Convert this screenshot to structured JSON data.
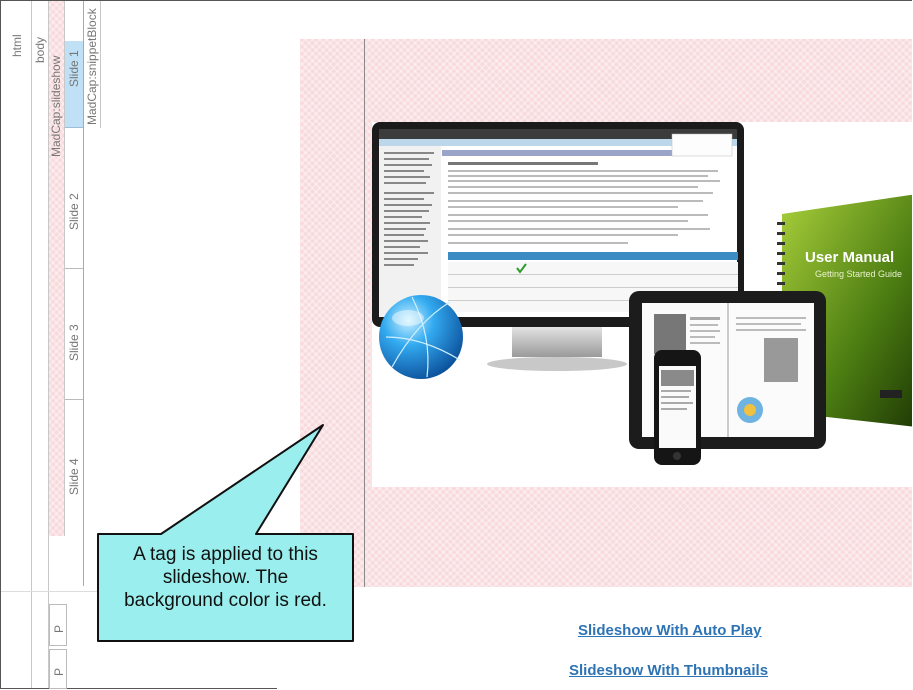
{
  "structure_bar": {
    "html_label": "html",
    "body_label": "body",
    "slideshow_label": "MadCap:slideshow",
    "slides": [
      "Slide 1",
      "Slide 2",
      "Slide 3",
      "Slide 4"
    ],
    "snippet_label": "MadCap:snippetBlock",
    "paragraph_labels": [
      "P",
      "P"
    ]
  },
  "callout": {
    "text_lines": [
      "A tag is applied to this",
      "slideshow. The",
      "background color is red."
    ]
  },
  "slide_image": {
    "manual_title": "User Manual",
    "manual_subtitle": "Getting Started Guide"
  },
  "links": {
    "auto_play": "Slideshow With Auto Play",
    "thumbnails": "Slideshow With Thumbnails"
  },
  "colors": {
    "slideshow_bg": "#f8d9dc",
    "selected_slide": "#bfe0f5",
    "callout_fill": "#9aeeed",
    "link": "#2e74b5"
  }
}
